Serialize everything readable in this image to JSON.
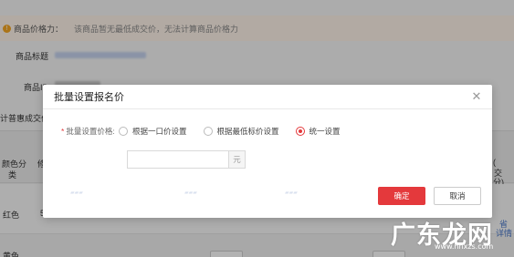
{
  "background": {
    "notice": {
      "label": "商品价格力：",
      "message": "该商品暂无最低成交价，无法计算商品价格力"
    },
    "fields": {
      "product_title_label": "商品标题",
      "product_id_label": "商品ID",
      "price_label_partial": "计普惠成交价"
    },
    "table": {
      "col_color_line1": "颜色分",
      "col_color_line2": "类",
      "col2_partial": "修",
      "right_col_line1": "(",
      "right_col_line2": "交",
      "right_col_line3": "分)",
      "row1_color": "红色",
      "row1_num": "5",
      "row1_right_line1": "省",
      "row1_right_line2": "详情",
      "row2_color": "黄色"
    }
  },
  "modal": {
    "title": "批量设置报名价",
    "close_icon": "close-icon",
    "field_label": "批量设置价格:",
    "required_mark": "*",
    "options": [
      {
        "label": "根据一口价设置",
        "checked": false
      },
      {
        "label": "根据最低标价设置",
        "checked": false
      },
      {
        "label": "统一设置",
        "checked": true
      }
    ],
    "price_input": {
      "value": "",
      "placeholder": ""
    },
    "unit": "元",
    "ok_label": "确定",
    "cancel_label": "取消",
    "accent_color": "#e4393c"
  },
  "watermark": {
    "logo_text": "广东龙网",
    "url": "www.hnxzs.com"
  }
}
